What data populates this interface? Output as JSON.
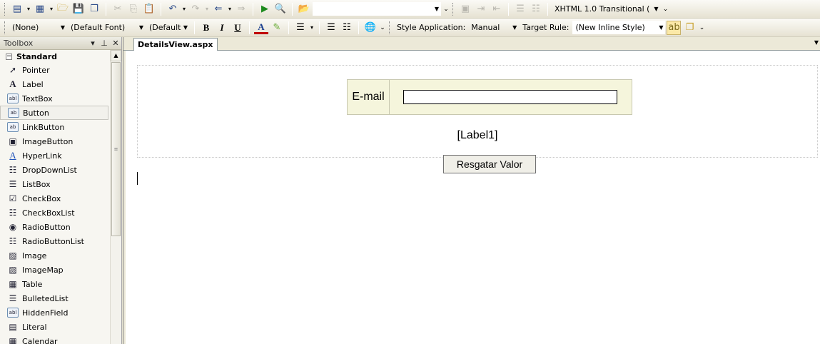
{
  "toolbar1": {
    "target_combo_value": "",
    "doctype_combo": "XHTML 1.0 Transitional ("
  },
  "toolbar2": {
    "block_format": "(None)",
    "font_name": "(Default Font)",
    "font_size": "(Default",
    "bold": "B",
    "italic": "I",
    "underline": "U",
    "font_color": "A",
    "style_application_label": "Style Application:",
    "style_application_value": "Manual",
    "target_rule_label": "Target Rule:",
    "target_rule_value": "(New Inline Style)"
  },
  "toolbox": {
    "title": "Toolbox",
    "section": "Standard",
    "items": [
      {
        "label": "Pointer",
        "icon": "pointer-icon",
        "glyph": "➚"
      },
      {
        "label": "Label",
        "icon": "label-icon",
        "glyph": "A"
      },
      {
        "label": "TextBox",
        "icon": "textbox-icon",
        "glyph": "abl"
      },
      {
        "label": "Button",
        "icon": "button-icon",
        "glyph": "ab"
      },
      {
        "label": "LinkButton",
        "icon": "linkbutton-icon",
        "glyph": "ab"
      },
      {
        "label": "ImageButton",
        "icon": "imagebutton-icon",
        "glyph": "▣"
      },
      {
        "label": "HyperLink",
        "icon": "hyperlink-icon",
        "glyph": "A"
      },
      {
        "label": "DropDownList",
        "icon": "dropdownlist-icon",
        "glyph": "☷"
      },
      {
        "label": "ListBox",
        "icon": "listbox-icon",
        "glyph": "☰"
      },
      {
        "label": "CheckBox",
        "icon": "checkbox-icon",
        "glyph": "☑"
      },
      {
        "label": "CheckBoxList",
        "icon": "checkboxlist-icon",
        "glyph": "☷"
      },
      {
        "label": "RadioButton",
        "icon": "radiobutton-icon",
        "glyph": "◉"
      },
      {
        "label": "RadioButtonList",
        "icon": "radiobuttonlist-icon",
        "glyph": "☷"
      },
      {
        "label": "Image",
        "icon": "image-icon",
        "glyph": "▨"
      },
      {
        "label": "ImageMap",
        "icon": "imagemap-icon",
        "glyph": "▨"
      },
      {
        "label": "Table",
        "icon": "table-icon",
        "glyph": "▦"
      },
      {
        "label": "BulletedList",
        "icon": "bulletedlist-icon",
        "glyph": "☰"
      },
      {
        "label": "HiddenField",
        "icon": "hiddenfield-icon",
        "glyph": "abl"
      },
      {
        "label": "Literal",
        "icon": "literal-icon",
        "glyph": "▤"
      },
      {
        "label": "Calendar",
        "icon": "calendar-icon",
        "glyph": "▦"
      }
    ],
    "selected": "Button"
  },
  "document": {
    "tab_label": "DetailsView.aspx",
    "detailsview": {
      "field_header": "E-mail",
      "field_value": ""
    },
    "label_text": "[Label1]",
    "button_text": "Resgatar Valor"
  },
  "colors": {
    "detailsview_bg": "#f5f5dc",
    "toolbar_bg": "#ece9d8"
  }
}
